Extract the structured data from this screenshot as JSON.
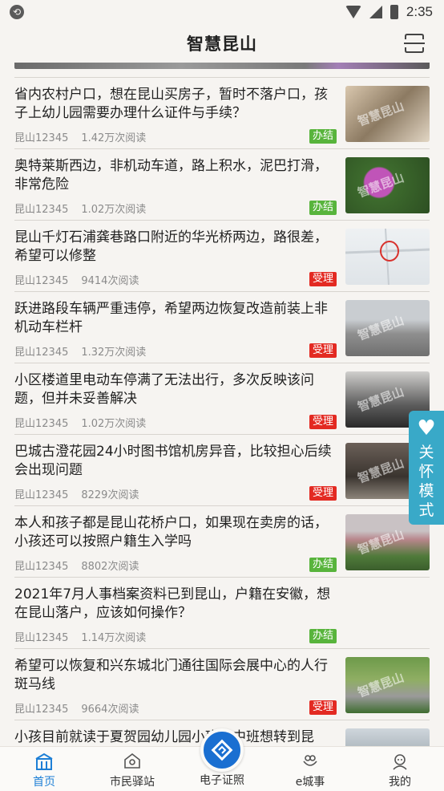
{
  "status_bar": {
    "time": "2:35"
  },
  "header": {
    "title": "智慧昆山"
  },
  "news": [
    {
      "title": "省内农村户口，想在昆山买房子，暂时不落户口，孩子上幼儿园需要办理什么证件与手续？",
      "source": "昆山12345",
      "reads": "1.42万次阅读",
      "status": "办结",
      "status_type": "done",
      "thumb": "food"
    },
    {
      "title": "奥特莱斯西边，非机动车道，路上积水，泥巴打滑，非常危险",
      "source": "昆山12345",
      "reads": "1.02万次阅读",
      "status": "办结",
      "status_type": "done",
      "thumb": "flower"
    },
    {
      "title": "昆山千灯石浦龚巷路口附近的华光桥两边，路很差，希望可以修整",
      "source": "昆山12345",
      "reads": "9414次阅读",
      "status": "受理",
      "status_type": "accept",
      "thumb": "map"
    },
    {
      "title": "跃进路段车辆严重违停，希望两边恢复改造前装上非机动车栏杆",
      "source": "昆山12345",
      "reads": "1.32万次阅读",
      "status": "受理",
      "status_type": "accept",
      "thumb": "street"
    },
    {
      "title": "小区楼道里电动车停满了无法出行，多次反映该问题，但并未妥善解决",
      "source": "昆山12345",
      "reads": "1.02万次阅读",
      "status": "受理",
      "status_type": "accept",
      "thumb": "bikes"
    },
    {
      "title": "巴城古澄花园24小时图书馆机房异音，比较担心后续会出现问题",
      "source": "昆山12345",
      "reads": "8229次阅读",
      "status": "受理",
      "status_type": "accept",
      "thumb": "library"
    },
    {
      "title": "本人和孩子都是昆山花桥户口，如果现在卖房的话，小孩还可以按照户籍生入学吗",
      "source": "昆山12345",
      "reads": "8802次阅读",
      "status": "办结",
      "status_type": "done",
      "thumb": "building"
    },
    {
      "title": "2021年7月人事档案资料已到昆山，户籍在安徽，想在昆山落户，应该如何操作？",
      "source": "昆山12345",
      "reads": "1.14万次阅读",
      "status": "办结",
      "status_type": "done",
      "thumb": ""
    },
    {
      "title": "希望可以恢复和兴东城北门通往国际会展中心的人行斑马线",
      "source": "昆山12345",
      "reads": "9664次阅读",
      "status": "受理",
      "status_type": "accept",
      "thumb": "road"
    },
    {
      "title": "小孩目前就读于夏贺园幼儿园小班，中班想转到昆",
      "source": "",
      "reads": "",
      "status": "",
      "status_type": "",
      "thumb": "partial"
    }
  ],
  "watermark": "智慧昆山",
  "care_mode": {
    "label": "关怀模式"
  },
  "nav": {
    "home": "首页",
    "station": "市民驿站",
    "certificate": "电子证照",
    "city": "e城事",
    "mine": "我的"
  },
  "colors": {
    "accent": "#1d7fd6",
    "done": "#58b43c",
    "accept": "#e32a22",
    "care": "#39a9c8"
  }
}
